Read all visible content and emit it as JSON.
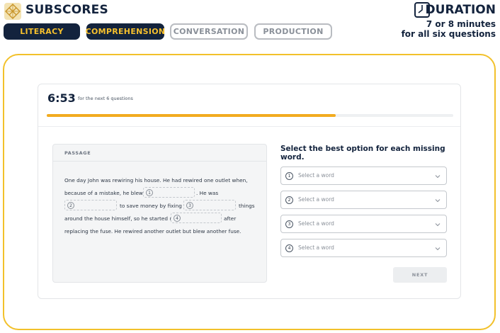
{
  "brand": {
    "title": "SUBSCORES",
    "logo_icon": "diamond-grid-logo"
  },
  "subscores": [
    {
      "label": "LITERACY",
      "active": true
    },
    {
      "label": "COMPREHENSION",
      "active": true
    },
    {
      "label": "CONVERSATION",
      "active": false
    },
    {
      "label": "PRODUCTION",
      "active": false
    }
  ],
  "duration": {
    "title": "DURATION",
    "line1": "7 or 8 minutes",
    "line2": "for all six questions",
    "icon": "clock-icon"
  },
  "task": {
    "timer": "6:53",
    "timer_note": "for the next 6 questions",
    "progress": 0.71,
    "passage_label": "PASSAGE",
    "passage": {
      "l1": "One day John was rewiring his house. He had rewired one outlet when,",
      "l2a": "because of a mistake, he blew a",
      "l2b": ". He was",
      "l3a": "to save money by fixing a",
      "l3b": "things",
      "l4a": "around the house himself, so he started up",
      "l4b": "after",
      "l5": "replacing the fuse. He rewired another outlet but blew another fuse."
    },
    "blanks": [
      "1",
      "2",
      "3",
      "4"
    ],
    "instruction": "Select the best option for each missing word.",
    "selects": [
      {
        "num": "1",
        "placeholder": "Select a word"
      },
      {
        "num": "2",
        "placeholder": "Select a word"
      },
      {
        "num": "3",
        "placeholder": "Select a word"
      },
      {
        "num": "4",
        "placeholder": "Select a word"
      }
    ],
    "next_label": "NEXT"
  },
  "colors": {
    "navy": "#13233d",
    "gold": "#f6c02d",
    "frame": "#f2c12b",
    "progress": "#f2ab1f"
  }
}
